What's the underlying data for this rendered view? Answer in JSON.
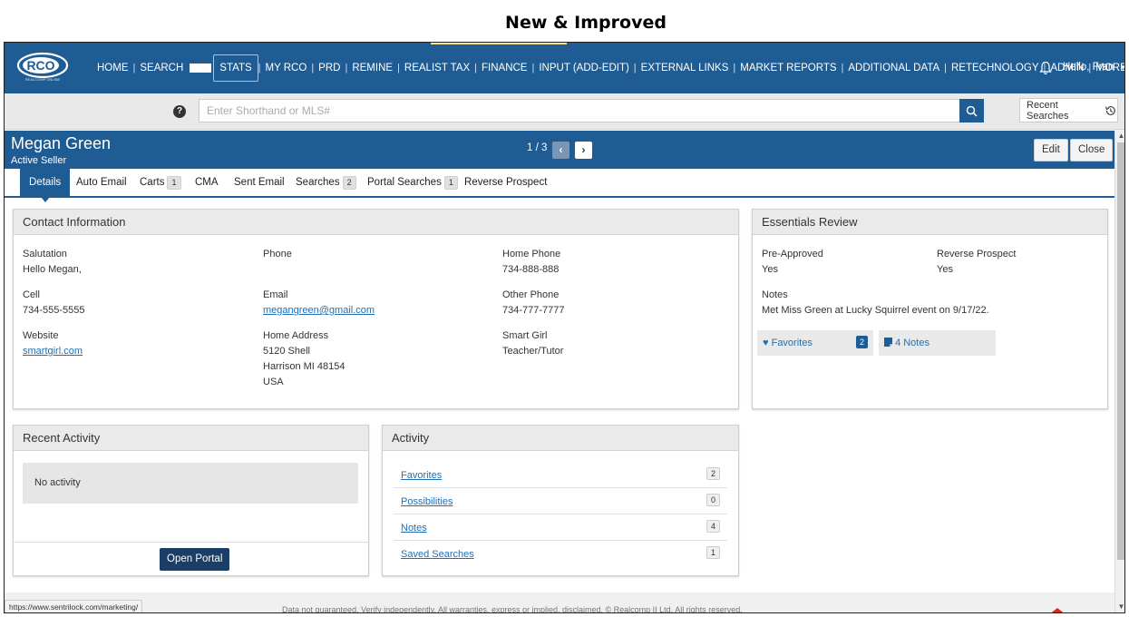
{
  "slide": {
    "title": "New & Improved"
  },
  "topnav": {
    "items": [
      {
        "label": "HOME"
      },
      {
        "label": "SEARCH"
      },
      {
        "label": "STATS"
      },
      {
        "label": "MY RCO"
      },
      {
        "label": "PRD"
      },
      {
        "label": "REMINE"
      },
      {
        "label": "REALIST TAX"
      },
      {
        "label": "FINANCE"
      },
      {
        "label": "INPUT (ADD-EDIT)"
      },
      {
        "label": "EXTERNAL LINKS"
      },
      {
        "label": "MARKET REPORTS"
      },
      {
        "label": "ADDITIONAL DATA"
      },
      {
        "label": "RETECHNOLOGY"
      },
      {
        "label": "ADMIN"
      },
      {
        "label": "MORE"
      }
    ],
    "active": "STATS",
    "user_greeting": "Hello, Fran",
    "logo_text": "RCO"
  },
  "search": {
    "placeholder": "Enter Shorthand or MLS#",
    "recent_label": "Recent Searches"
  },
  "contact": {
    "name": "Megan Green",
    "status": "Active Seller",
    "pager": "1 / 3",
    "edit_label": "Edit",
    "close_label": "Close"
  },
  "tabs": [
    {
      "label": "Details",
      "badge": null
    },
    {
      "label": "Auto Email",
      "badge": null
    },
    {
      "label": "Carts",
      "badge": "1"
    },
    {
      "label": "CMA",
      "badge": null
    },
    {
      "label": "Sent Email",
      "badge": null
    },
    {
      "label": "Searches",
      "badge": "2"
    },
    {
      "label": "Portal Searches",
      "badge": "1"
    },
    {
      "label": "Reverse Prospect",
      "badge": null
    }
  ],
  "contact_info": {
    "title": "Contact Information",
    "salutation_label": "Salutation",
    "salutation": "Hello Megan,",
    "phone_label": "Phone",
    "home_phone_label": "Home Phone",
    "home_phone": "734-888-888",
    "cell_label": "Cell",
    "cell": "734-555-5555",
    "email_label": "Email",
    "email": "megangreen@gmail.com",
    "other_phone_label": "Other Phone",
    "other_phone": "734-777-7777",
    "website_label": "Website",
    "website": "smartgirl.com",
    "home_address_label": "Home Address",
    "address_line1": "5120 Shell",
    "address_line2": "Harrison MI 48154",
    "address_line3": "USA",
    "company": "Smart Girl",
    "job_title": "Teacher/Tutor"
  },
  "essentials": {
    "title": "Essentials Review",
    "preapproved_label": "Pre-Approved",
    "preapproved": "Yes",
    "reverse_label": "Reverse Prospect",
    "reverse": "Yes",
    "notes_label": "Notes",
    "notes": "Met Miss Green at Lucky Squirrel event on 9/17/22.",
    "favorites_label": "Favorites",
    "favorites_count": "2",
    "notes_tile": "4 Notes"
  },
  "recent_activity": {
    "title": "Recent Activity",
    "empty": "No activity",
    "open_portal": "Open Portal"
  },
  "activity": {
    "title": "Activity",
    "rows": [
      {
        "label": "Favorites",
        "count": "2"
      },
      {
        "label": "Possibilities",
        "count": "0"
      },
      {
        "label": "Notes",
        "count": "4"
      },
      {
        "label": "Saved Searches",
        "count": "1"
      }
    ]
  },
  "statusbar": {
    "url": "https://www.sentrilock.com/marketing/",
    "footer": "Data not guaranteed. Verify independently. All warranties, express or implied, disclaimed. © Realcomp II Ltd. All rights reserved."
  },
  "colors": {
    "brand": "#1f5c94",
    "link": "#1f6fb5",
    "dark_button": "#1a3e66"
  }
}
